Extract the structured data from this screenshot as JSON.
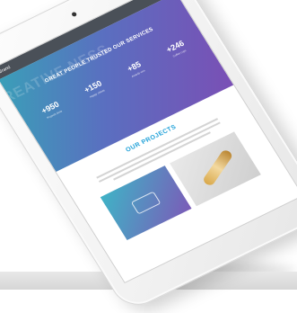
{
  "nav": {
    "brand": "Brand"
  },
  "hero": {
    "background_text": "REATIVE NESS",
    "title": "GREAT PEOPLE TRUSTED OUR SERVICES",
    "stats": [
      {
        "value": "+950",
        "label": "Projects done"
      },
      {
        "value": "+150",
        "label": "Happy clients"
      },
      {
        "value": "+85",
        "label": "Awards won"
      },
      {
        "value": "+246",
        "label": "Coffee cups"
      }
    ]
  },
  "projects": {
    "title": "OUR PROJECTS"
  },
  "colors": {
    "accent": "#1ea0d8",
    "hero_start": "#3a9fb8",
    "hero_end": "#7a4fb5"
  }
}
